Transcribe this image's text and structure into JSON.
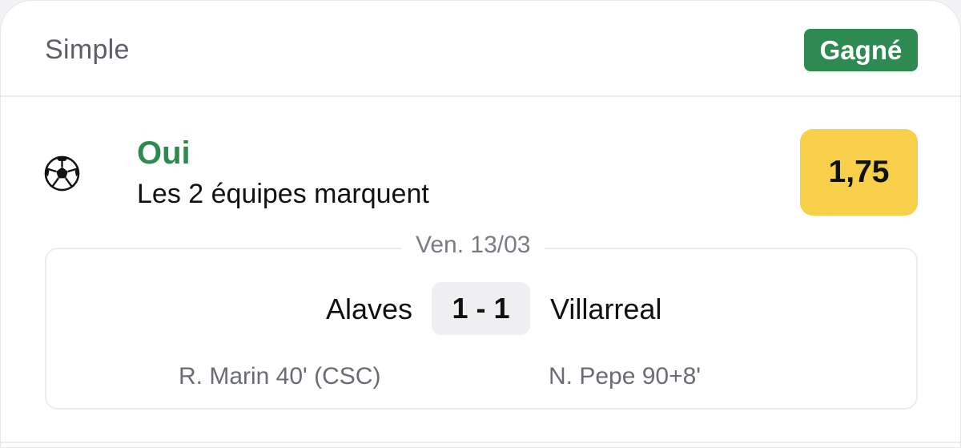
{
  "bet": {
    "type_label": "Simple",
    "status": "Gagné",
    "status_color": "#2f8a52"
  },
  "selection": {
    "sport_icon": "soccer-ball-icon",
    "pick": "Oui",
    "market": "Les 2 équipes marquent",
    "odds": "1,75",
    "odds_color": "#f7cf48"
  },
  "match": {
    "date": "Ven. 13/03",
    "home_team": "Alaves",
    "away_team": "Villarreal",
    "score": "1 - 1",
    "home_scorers": "R. Marin 40' (CSC)",
    "away_scorers": "N. Pepe 90+8'"
  }
}
